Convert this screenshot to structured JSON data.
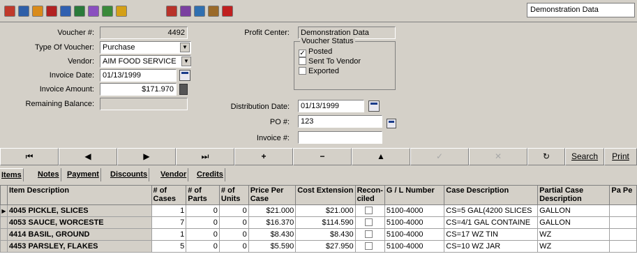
{
  "toolbar": {
    "icons": [
      "toolbar-icon-1",
      "toolbar-icon-2",
      "toolbar-icon-3",
      "toolbar-icon-4",
      "toolbar-icon-5",
      "toolbar-icon-6",
      "toolbar-icon-7",
      "toolbar-icon-8",
      "toolbar-icon-9",
      "toolbar-icon-10",
      "toolbar-icon-11",
      "toolbar-icon-12",
      "toolbar-icon-13",
      "toolbar-icon-14"
    ],
    "company": "Demonstration Data"
  },
  "form": {
    "voucher_label": "Voucher #:",
    "voucher_value": "4492",
    "type_label": "Type Of Voucher:",
    "type_value": "Purchase",
    "vendor_label": "Vendor:",
    "vendor_value": "AIM FOOD SERVICE",
    "invoice_date_label": "Invoice Date:",
    "invoice_date_value": "01/13/1999",
    "invoice_amount_label": "Invoice Amount:",
    "invoice_amount_value": "$171.970",
    "remaining_label": "Remaining Balance:",
    "remaining_value": "",
    "profit_center_label": "Profit Center:",
    "profit_center_value": "Demonstration Data",
    "status_title": "Voucher Status",
    "status_posted": "Posted",
    "status_sent": "Sent To Vendor",
    "status_exported": "Exported",
    "distribution_label": "Distribution Date:",
    "distribution_value": "01/13/1999",
    "po_label": "PO #:",
    "po_value": "123",
    "invoice_no_label": "Invoice #:",
    "invoice_no_value": ""
  },
  "nav": {
    "first": "⏮",
    "prev": "◀",
    "next": "▶",
    "last": "⏭",
    "add": "+",
    "delete": "−",
    "up": "▲",
    "post": "✓",
    "cancel": "✕",
    "refresh": "↻",
    "search": "Search",
    "print": "Print"
  },
  "tabs": [
    "Items",
    "Notes",
    "Payment",
    "Discounts",
    "Vendor",
    "Credits"
  ],
  "grid": {
    "headers": [
      "Item Description",
      "# of Cases",
      "# of Parts",
      "# of Units",
      "Price Per Case",
      "Cost Extension",
      "Recon-ciled",
      "G / L Number",
      "Case Description",
      "Partial Case Description",
      "Pa Pe"
    ],
    "rows": [
      {
        "item": "4045 PICKLE, SLICES",
        "cases": "1",
        "parts": "0",
        "units": "0",
        "price": "$21.000",
        "cost": "$21.000",
        "gl": "5100-4000",
        "case_desc": "CS=5 GAL(4200 SLICES",
        "partial": "GALLON"
      },
      {
        "item": "4053 SAUCE, WORCESTE",
        "cases": "7",
        "parts": "0",
        "units": "0",
        "price": "$16.370",
        "cost": "$114.590",
        "gl": "5100-4000",
        "case_desc": "CS=4/1 GAL CONTAINE",
        "partial": "GALLON"
      },
      {
        "item": "4414 BASIL, GROUND",
        "cases": "1",
        "parts": "0",
        "units": "0",
        "price": "$8.430",
        "cost": "$8.430",
        "gl": "5100-4000",
        "case_desc": "CS=17 WZ TIN",
        "partial": "WZ"
      },
      {
        "item": "4453 PARSLEY, FLAKES",
        "cases": "5",
        "parts": "0",
        "units": "0",
        "price": "$5.590",
        "cost": "$27.950",
        "gl": "5100-4000",
        "case_desc": "CS=10 WZ JAR",
        "partial": "WZ"
      }
    ]
  },
  "colors": {
    "face": "#d4d0c8",
    "icon_colors": [
      "#c0392b",
      "#2e5fa8",
      "#d98b1a",
      "#b22222",
      "#3060b0",
      "#2a7a3a",
      "#8a4fbf",
      "#3a8a3a",
      "#d4a017",
      "#b8322a",
      "#7a3fa0",
      "#2f6fb0",
      "#9a6a2a",
      "#c02020"
    ]
  }
}
